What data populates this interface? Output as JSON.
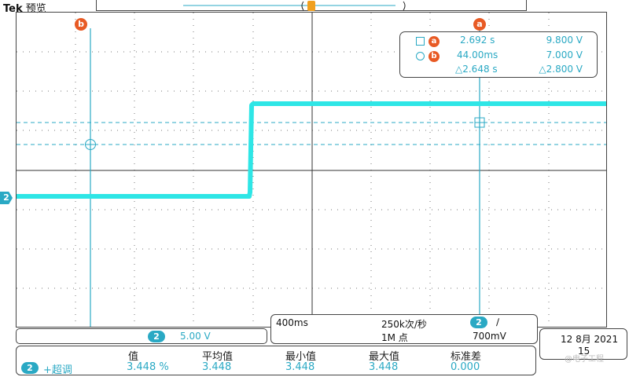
{
  "header": {
    "brand": "Tek",
    "mode": "预览"
  },
  "trigger_marker": "T",
  "cursors": {
    "a_label": "a",
    "b_label": "b"
  },
  "readout": {
    "a": {
      "tag": "a",
      "time": "2.692 s",
      "volt": "9.800 V"
    },
    "b": {
      "tag": "b",
      "time": "44.00ms",
      "volt": "7.000 V"
    },
    "delta": {
      "time": "△2.648 s",
      "volt": "△2.800 V"
    }
  },
  "channel_marker": "2",
  "channel_box": {
    "ch": "2",
    "scale": "5.00 V"
  },
  "acquisition": {
    "timebase": "400ms",
    "sample_rate": "250k次/秒",
    "record_length": "1M 点",
    "trig_ch": "2",
    "trig_slope": "∕",
    "trig_level": "700mV"
  },
  "datetime": {
    "date": "12 8月 2021",
    "time": "15"
  },
  "measurements": {
    "headers": [
      "值",
      "平均值",
      "最小值",
      "最大值",
      "标准差"
    ],
    "channel": "2",
    "name": "+超调",
    "values": [
      "3.448 %",
      "3.448",
      "3.448",
      "3.448",
      "0.000"
    ]
  },
  "watermark": "@电子工程",
  "colors": {
    "trace": "#2ee6e6",
    "cursor": "#2aa9c4",
    "tag": "#e85a24"
  }
}
